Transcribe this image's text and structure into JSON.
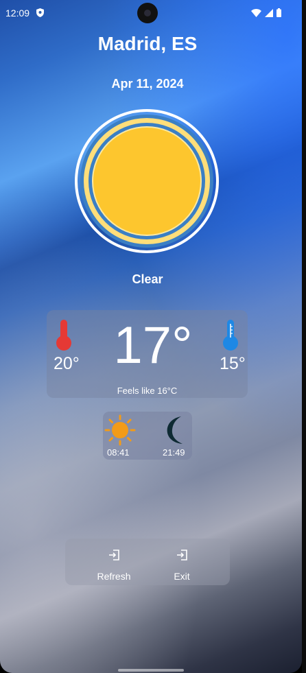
{
  "status_bar": {
    "time": "12:09"
  },
  "location": {
    "city": "Madrid, ES",
    "date": "Apr 11, 2024"
  },
  "weather": {
    "condition": "Clear",
    "temperature": "17°",
    "high": "20°",
    "low": "15°",
    "feels_like": "Feels like 16°C"
  },
  "sun": {
    "sunrise": "08:41",
    "sunset": "21:49"
  },
  "actions": {
    "refresh_label": "Refresh",
    "exit_label": "Exit"
  },
  "colors": {
    "sun_fill": "#FDC62E",
    "ring_blue": "#3B7FC4",
    "thermo_high": "#E53935",
    "thermo_low": "#1E88E5",
    "sunrise_icon": "#F29B18",
    "moon_icon": "#0E2A33"
  },
  "icons": [
    "shield-icon",
    "wifi-icon",
    "signal-icon",
    "battery-icon",
    "thermometer-high-icon",
    "thermometer-low-icon",
    "sunrise-icon",
    "moon-icon",
    "refresh-icon",
    "exit-icon"
  ]
}
